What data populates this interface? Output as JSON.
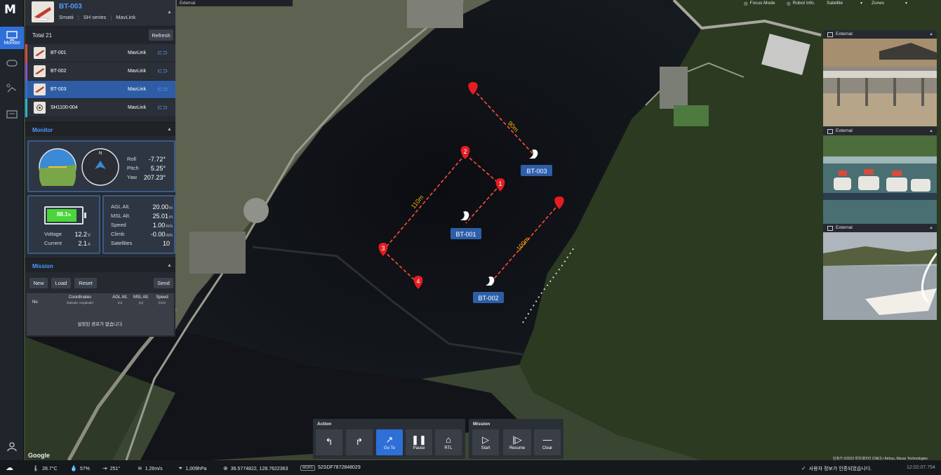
{
  "app": {
    "logo": "M"
  },
  "rail": {
    "items": [
      {
        "label": "Monitor",
        "icon": "monitor-icon",
        "active": true
      },
      {
        "label": "",
        "icon": "gamepad-icon"
      },
      {
        "label": "",
        "icon": "route-icon"
      },
      {
        "label": "",
        "icon": "console-icon"
      },
      {
        "label": "",
        "icon": "user-icon"
      }
    ]
  },
  "device": {
    "name": "BT-003",
    "meta": [
      "Smatii",
      "SH series",
      "MavLink"
    ]
  },
  "device_list": {
    "total_label": "Total 21",
    "refresh_label": "Refresh",
    "rows": [
      {
        "name": "BT-001",
        "protocol": "MavLink",
        "stripe": "#e0483c"
      },
      {
        "name": "BT-002",
        "protocol": "MavLink",
        "stripe": "#8a4fd8"
      },
      {
        "name": "BT-003",
        "protocol": "MavLink",
        "stripe": "#2e6fd8"
      },
      {
        "name": "SH1100-004",
        "protocol": "MavLink",
        "stripe": "#25b6d2"
      }
    ]
  },
  "monitor": {
    "title": "Monitor",
    "attitude": {
      "roll_label": "Roll",
      "roll": "-7.72°",
      "pitch_label": "Pitch",
      "pitch": "5.25°",
      "yaw_label": "Yaw",
      "yaw": "207.23°"
    },
    "battery": {
      "percent_text": "88.1",
      "percent_unit": "%",
      "level": 0.881
    },
    "voltage": {
      "label": "Voltage",
      "value": "12.2",
      "unit": "V"
    },
    "current": {
      "label": "Current",
      "value": "2.1",
      "unit": "A"
    },
    "agl": {
      "label": "AGL Alt.",
      "value": "20.00",
      "unit": "m"
    },
    "msl": {
      "label": "MSL Alt.",
      "value": "25.01",
      "unit": "m"
    },
    "speed": {
      "label": "Speed",
      "value": "1.00",
      "unit": "m/s"
    },
    "climb": {
      "label": "Climb",
      "value": "-0.00",
      "unit": "m/s"
    },
    "satellites": {
      "label": "Satellites",
      "value": "10"
    }
  },
  "mission": {
    "title": "Mission",
    "buttons": {
      "new": "New",
      "load": "Load",
      "reset": "Reset",
      "send": "Send"
    },
    "columns": {
      "no": "No",
      "coords": "Coordinates",
      "coords_sub": "(latitude, longitude)",
      "agl": "AGL Alt.",
      "agl_unit": "(m)",
      "msl": "MSL Alt.",
      "msl_unit": "(m)",
      "speed": "Speed",
      "speed_unit": "(m/s)"
    },
    "empty_text": "설정된 경로가 없습니다."
  },
  "top_bar": {
    "external_tab": "External",
    "focus_mode": "Focus Mode",
    "robot_info": "Robot Info.",
    "map_type": "Satellite",
    "zones": "Zones"
  },
  "cameras": [
    {
      "title": "External"
    },
    {
      "title": "External"
    },
    {
      "title": "External"
    }
  ],
  "map": {
    "vehicles": [
      {
        "id": "BT-003"
      },
      {
        "id": "BT-001"
      },
      {
        "id": "BT-002"
      }
    ],
    "waypoints": [
      "1",
      "2",
      "3",
      "4"
    ],
    "distances": [
      "90m",
      "110m",
      "100m"
    ],
    "google": "Google",
    "attribution": "단축키  ©2023 위치데이터 CNES / Airbus, Maxar Technologies"
  },
  "action_bar": {
    "title": "Action",
    "buttons": [
      {
        "label": "",
        "icon": "turn-left-icon"
      },
      {
        "label": "",
        "icon": "turn-right-icon"
      },
      {
        "label": "Go To",
        "icon": "goto-icon",
        "active": true
      },
      {
        "label": "Pause",
        "icon": "pause-icon"
      },
      {
        "label": "RTL",
        "icon": "home-icon"
      }
    ]
  },
  "mission_bar": {
    "title": "Mission",
    "buttons": [
      {
        "label": "Start",
        "icon": "play-icon"
      },
      {
        "label": "Resume",
        "icon": "resume-icon"
      },
      {
        "label": "Clear",
        "icon": "clear-icon"
      }
    ]
  },
  "status": {
    "temperature": "28.7°C",
    "humidity": "57%",
    "wind_dir": "251°",
    "wind_speed": "1.26m/s",
    "pressure": "1,009hPa",
    "coordinates": "36.5774822, 128.7622363",
    "mgrs_label": "MGRS",
    "mgrs": "52SDF7872848029",
    "message": "사용자 정보가 인증되었습니다.",
    "time": "12:02:07.754"
  }
}
